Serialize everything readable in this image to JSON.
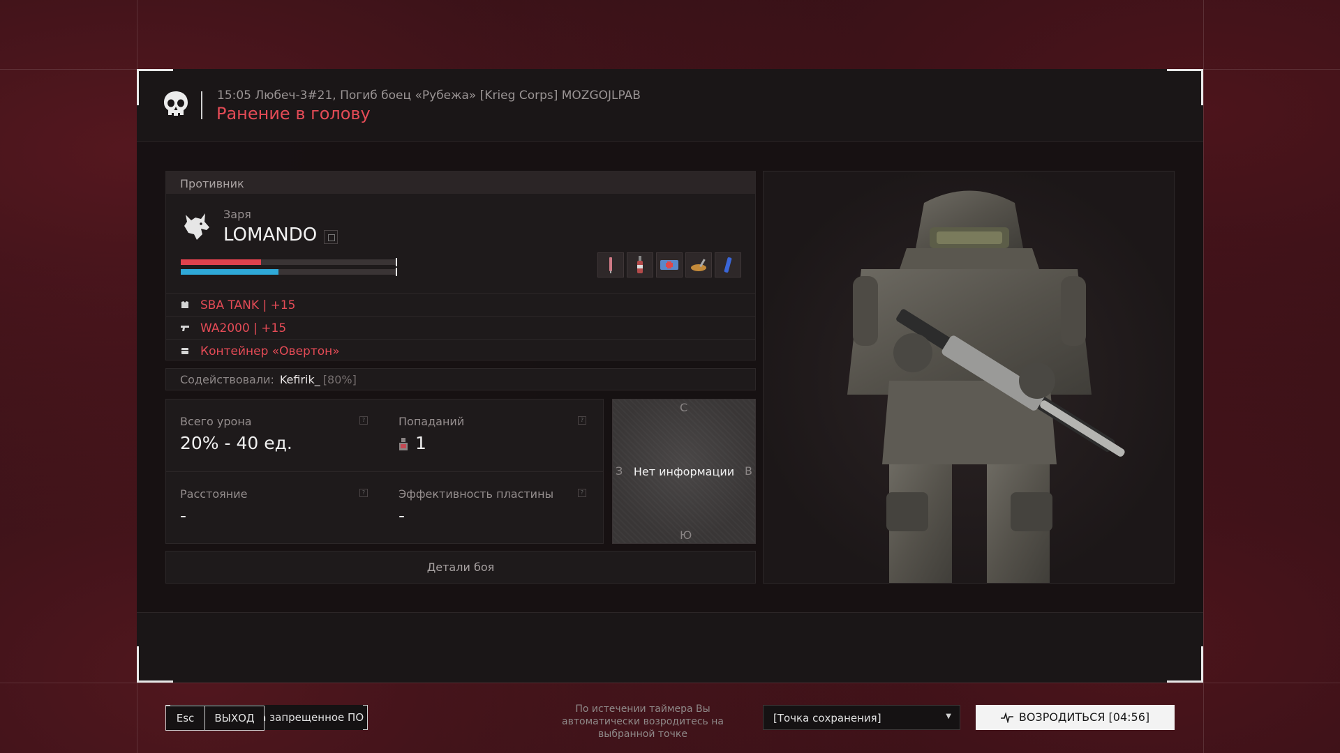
{
  "colors": {
    "accent_red": "#e44b56",
    "bar_health": "#e0424d",
    "bar_armor": "#2fa9d8"
  },
  "header": {
    "kill_line": "15:05 Любеч-3#21, Погиб боец «Рубежа» [Krieg Corps] MOZGOJLPAB",
    "cause": "Ранение в голову",
    "icon": "skull-icon"
  },
  "enemy": {
    "section_title": "Противник",
    "faction": "Заря",
    "name": "LOMANDO",
    "health_fraction": 0.37,
    "armor_fraction": 0.45,
    "items": [
      "syringe-icon",
      "bottle-icon",
      "medkit-icon",
      "food-icon",
      "stimulant-icon"
    ],
    "gear": [
      {
        "icon": "armor-icon",
        "label": "SBA TANK | +15"
      },
      {
        "icon": "rifle-icon",
        "label": "WA2000 | +15"
      },
      {
        "icon": "container-icon",
        "label": "Контейнер «Овертон»"
      }
    ]
  },
  "assist": {
    "label": "Содействовали:",
    "name": "Kefirik_",
    "percent": "[80%]"
  },
  "stats": {
    "total_damage": {
      "label": "Всего урона",
      "value": "20% - 40 ед."
    },
    "hits": {
      "label": "Попаданий",
      "value": "1"
    },
    "distance": {
      "label": "Расстояние",
      "value": "-"
    },
    "plate_efficiency": {
      "label": "Эффективность пластины",
      "value": "-"
    }
  },
  "minimap": {
    "north": "С",
    "west": "З",
    "east": "В",
    "south": "Ю",
    "message": "Нет информации"
  },
  "details_button": "Детали боя",
  "footer": {
    "report_button": "Пожаловаться на запрещенное ПО",
    "timer_note": "По истечении таймера Вы автоматически возродитесь на выбранной точке",
    "spawn_select": "[Точка сохранения]",
    "respawn_button": "ВОЗРОДИТЬСЯ [04:56]"
  },
  "bottom": {
    "esc_key": "Esc",
    "exit_button": "ВЫХОД"
  }
}
